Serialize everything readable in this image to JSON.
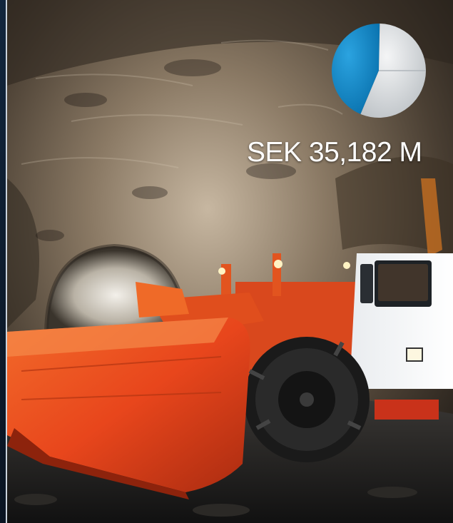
{
  "figure": {
    "amount_label": "SEK 35,182 M",
    "image_description_icon": "underground-loader-photo-icon",
    "pie": {
      "slices": [
        {
          "share": 0.44,
          "color": "#0f8ed1"
        },
        {
          "share": 0.56,
          "color": "#d8dcdf"
        }
      ]
    },
    "colors": {
      "accent_blue": "#0f8ed1",
      "loader_orange": "#e8461c",
      "left_band": "#12263d"
    }
  }
}
